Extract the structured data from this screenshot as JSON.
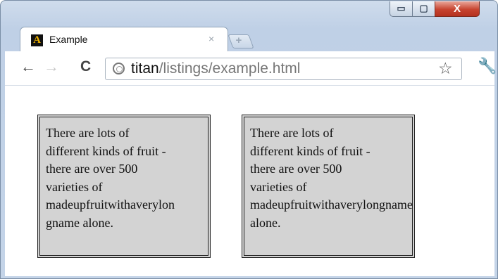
{
  "window": {
    "controls": {
      "minimize": "▭",
      "maximize": "▢",
      "close": "X"
    }
  },
  "tab": {
    "title": "Example",
    "favicon_letter": "A",
    "close_glyph": "×",
    "new_tab_glyph": "+"
  },
  "toolbar": {
    "back_glyph": "←",
    "forward_glyph": "→",
    "reload_glyph": "C",
    "url_host": "titan",
    "url_path": "/listings/example.html",
    "bookmark_glyph": "☆",
    "menu_glyph": "🔧"
  },
  "content": {
    "box1_lines": [
      "There are lots of",
      "different kinds of fruit -",
      "there are over 500",
      "varieties of",
      "madeupfruitwithaverylon",
      "gname alone."
    ],
    "box2_lines": [
      "There are lots of",
      "different kinds of fruit -",
      "there are over 500",
      "varieties of",
      "madeupfruitwithaverylongname",
      "alone."
    ]
  }
}
